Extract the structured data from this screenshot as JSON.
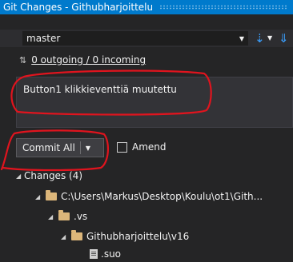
{
  "window": {
    "title": "Git Changes - Githubharjoittelu"
  },
  "branch": {
    "selected": "master",
    "icons": {
      "fetch": "fetch-down-arrow-icon",
      "pull": "pull-down-arrow-icon",
      "caret": "chevron-down-icon"
    }
  },
  "sync": {
    "arrows": "⇅",
    "link": "0 outgoing / 0 incoming"
  },
  "commit": {
    "message": "Button1 klikkieventtiä muutettu",
    "commit_all_label": "Commit All",
    "amend_label": "Amend"
  },
  "tree": {
    "changes_label": "Changes (4)",
    "path_root": "C:\\Users\\Markus\\Desktop\\Koulu\\ot1\\Gith...",
    "folder_vs": ".vs",
    "folder_sub": "Githubharjoittelu\\v16",
    "file_partial": ".suo"
  },
  "colors": {
    "titlebar": "#007acc",
    "background": "#252526",
    "accent_arrow": "#3aa0ff",
    "annotation": "#e0141e"
  }
}
